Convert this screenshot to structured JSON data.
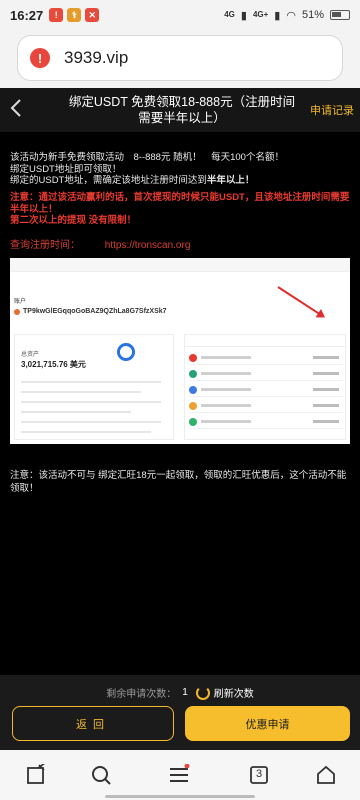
{
  "status": {
    "time": "16:27",
    "battery": "51%",
    "network_1": "4G",
    "network_2": "4G+"
  },
  "browser": {
    "url": "3939.vip"
  },
  "header": {
    "title": "绑定USDT 免费领取18-888元（注册时间需要半年以上）",
    "right_link": "申请记录"
  },
  "content": {
    "line1": "该活动为新手免费领取活动　8--888元 随机！　每天100个名额！",
    "line2": "绑定USDT地址即可领取！",
    "line3_prefix": "绑定的USDT地址，需确定该地址注册时间达到",
    "line3_bold": "半年以上！",
    "warning1": "注意：通过该活动赢利的话，首次提现的时候只能USDT，且该地址注册时间需要半年以上！",
    "warning2": "第二次以上的提现 没有限制！",
    "query_label": "查询注册时间：",
    "query_link": "https://tronscan.org",
    "screenshot": {
      "account_label": "账户",
      "address": "TP9kwGlEGqqoGoBAZ9QZhLa8G7SfzXSk7",
      "total_label": "总资产",
      "balance": "3,021,715.76 美元"
    },
    "note": "注意：该活动不可与 绑定汇旺18元一起领取，领取的汇旺优惠后，这个活动不能领取！"
  },
  "actions": {
    "remain_label": "剩余申请次数：",
    "remain_count": "1",
    "refresh_label": "刷新次数",
    "back_label": "返回",
    "apply_label": "优惠申请"
  },
  "nav": {
    "tabs_count": "3"
  }
}
